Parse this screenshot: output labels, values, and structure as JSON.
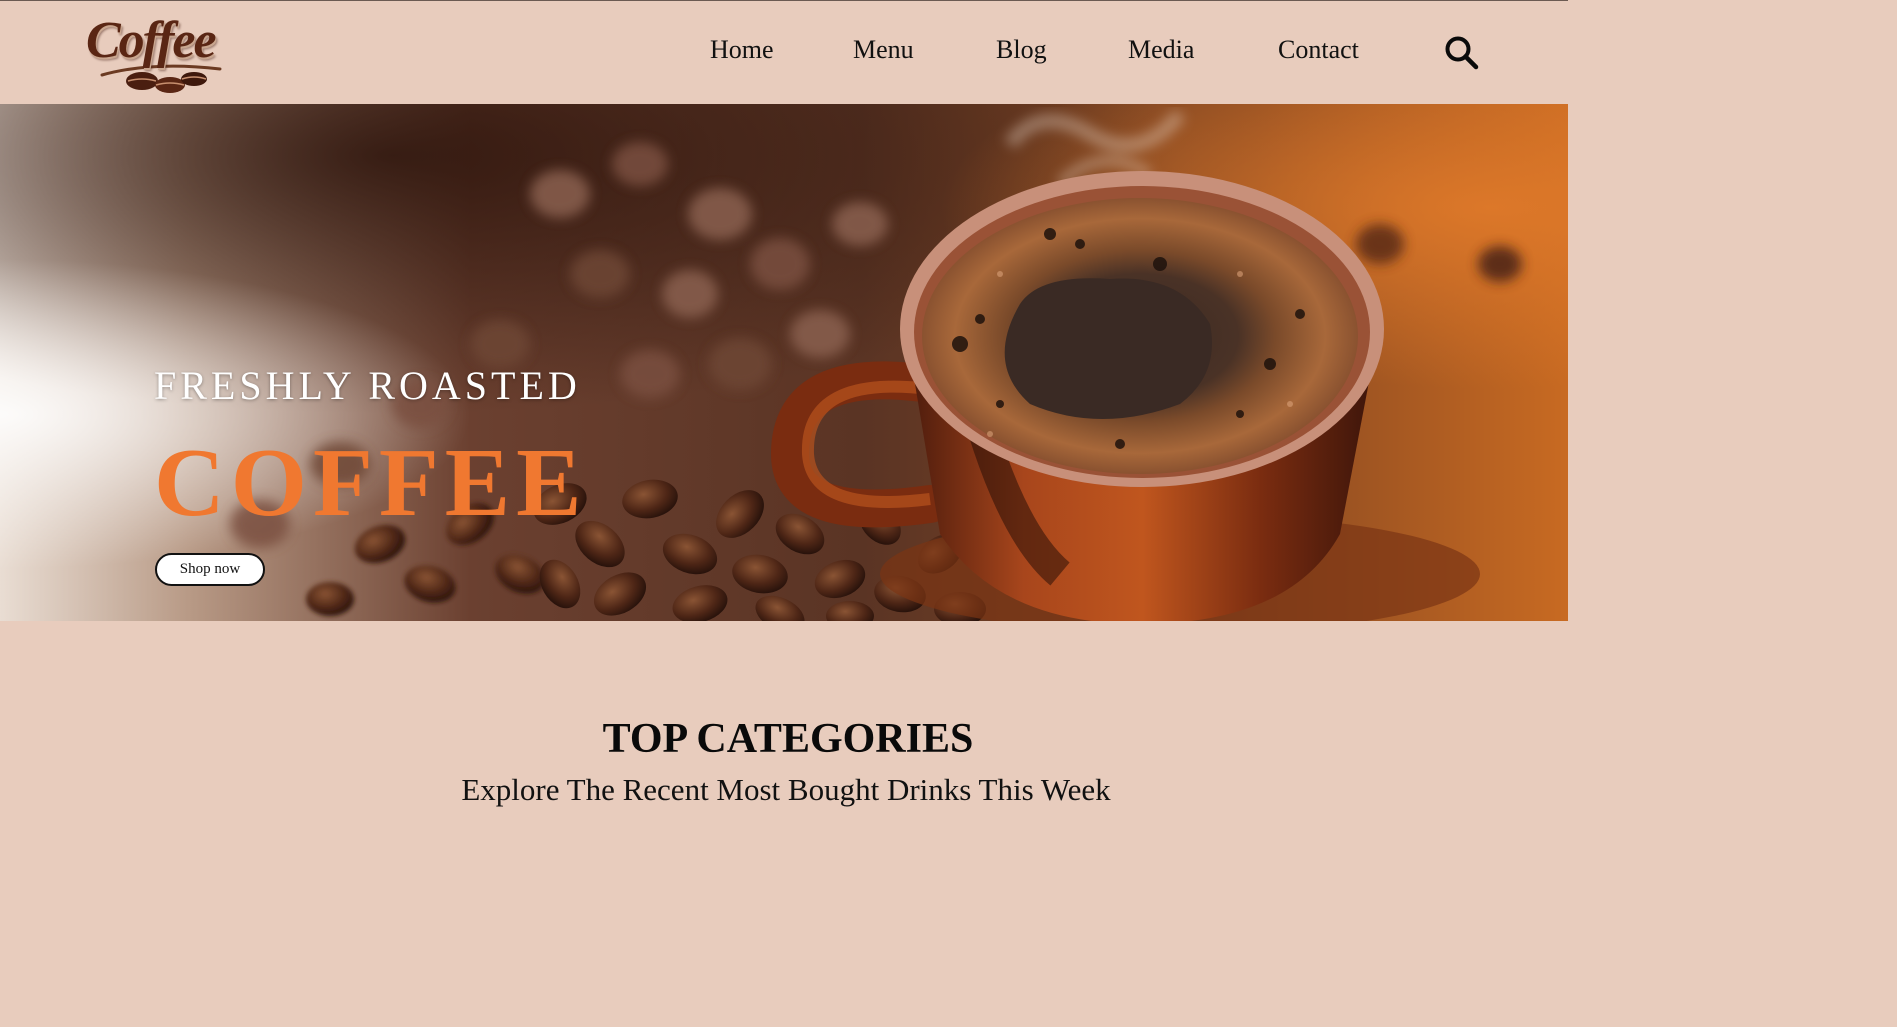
{
  "brand": {
    "logo_text": "Coffee",
    "colors": {
      "background": "#e8ccbd",
      "accent": "#f07830",
      "logo": "#5a2614"
    }
  },
  "nav": {
    "items": [
      {
        "label": "Home"
      },
      {
        "label": "Menu"
      },
      {
        "label": "Blog"
      },
      {
        "label": "Media"
      },
      {
        "label": "Contact"
      }
    ],
    "search_icon": "search-icon"
  },
  "hero": {
    "subtitle": "FRESHLY ROASTED",
    "title": "COFFEE",
    "cta_label": "Shop now",
    "image": "coffee-cup-with-beans"
  },
  "categories": {
    "title": "TOP CATEGORIES",
    "subtitle": "Explore The Recent Most Bought Drinks This Week"
  }
}
